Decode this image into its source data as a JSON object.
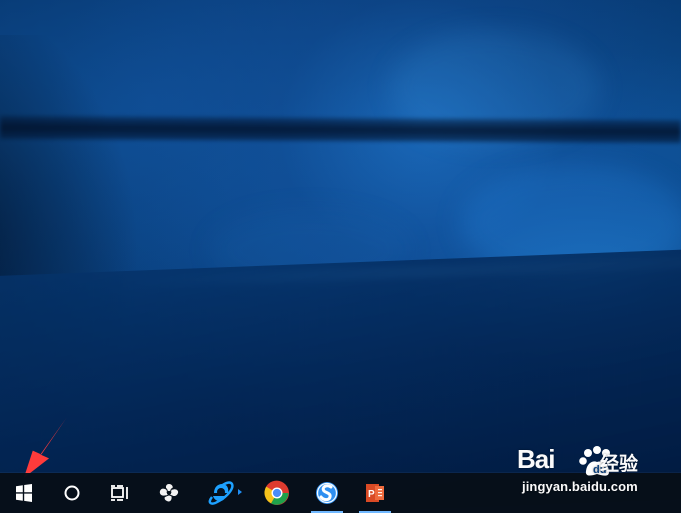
{
  "desktop": {
    "background_name": "Windows 10 hero wallpaper",
    "accent_color": "#0b4f93"
  },
  "taskbar": {
    "background_color": "#060f18",
    "active_indicator_color": "#70b8ff",
    "items": [
      {
        "name": "start",
        "icon": "windows-logo-icon"
      },
      {
        "name": "cortana-search",
        "icon": "circle-search-icon"
      },
      {
        "name": "task-view",
        "icon": "task-view-icon"
      },
      {
        "name": "pinned-app",
        "icon": "flower-app-icon"
      },
      {
        "name": "internet-explorer",
        "icon": "internet-explorer-icon"
      },
      {
        "name": "chrome",
        "icon": "chrome-icon"
      },
      {
        "name": "sogou-browser",
        "icon": "sogou-browser-icon"
      },
      {
        "name": "powerpoint",
        "icon": "powerpoint-icon"
      }
    ]
  },
  "annotation": {
    "arrow_color": "#ff3b3b",
    "icon": "red-arrow-icon"
  },
  "watermark": {
    "brand": "Bai",
    "chinese": "经验",
    "url": "jingyan.baidu.com"
  }
}
